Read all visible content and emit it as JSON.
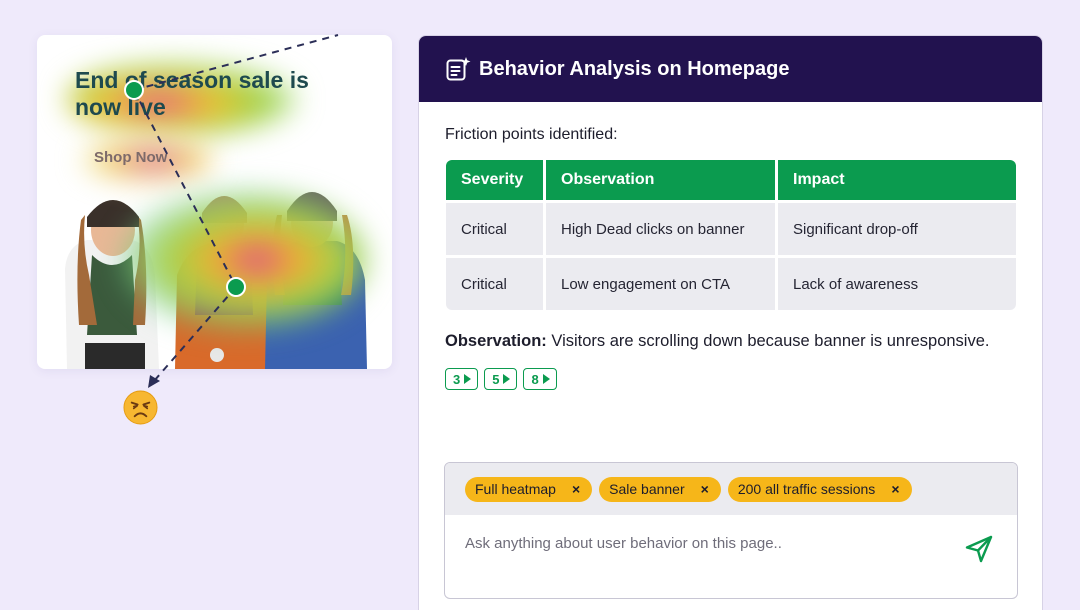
{
  "banner": {
    "title": "End of season sale is now live",
    "cta": "Shop Now"
  },
  "panel": {
    "title": "Behavior Analysis on Homepage",
    "header_icon": "ai-document-icon",
    "friction_label": "Friction points identified:",
    "table": {
      "headers": [
        "Severity",
        "Observation",
        "Impact"
      ],
      "rows": [
        [
          "Critical",
          "High Dead clicks on banner",
          "Significant drop-off"
        ],
        [
          "Critical",
          "Low engagement on CTA",
          "Lack of awareness"
        ]
      ]
    },
    "observation_label": "Observation:",
    "observation_text": "Visitors are scrolling down because banner is unresponsive.",
    "chips": [
      "3",
      "5",
      "8"
    ]
  },
  "chat": {
    "tags": [
      "Full heatmap",
      "Sale banner",
      "200 all traffic sessions"
    ],
    "tag_remove_glyph": "×",
    "placeholder": "Ask anything about user behavior on this page..",
    "send_icon": "send-icon"
  },
  "colors": {
    "background": "#efeafb",
    "header": "#22124f",
    "accent_green": "#0b9b4f",
    "tag_yellow": "#f6b619"
  }
}
